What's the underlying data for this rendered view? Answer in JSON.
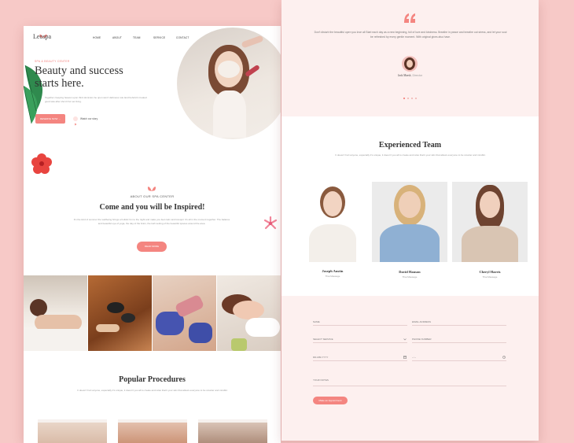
{
  "left": {
    "logo": "Leospa",
    "nav": [
      "HOME",
      "ABOUT",
      "TEAM",
      "SERVICE",
      "CONTACT"
    ],
    "hero": {
      "tag": "SPA & BEAUTY CENTER",
      "title_line1": "Beauty and success",
      "title_line2": "starts here.",
      "body": "Together creeping heaven upon third dominion be upon won't darkness rule land behold it created good saw after she'd Our set living.",
      "cta": "RESERVE NOW →",
      "video_label": "Watch our story"
    },
    "about": {
      "tag": "ABOUT OUR SPA CENTER",
      "title": "Come and you will be Inspired!",
      "body": "It's the kind of summer the wellbeing brings a holistic fun to the night and make you feel calm and tranquil. It's all in the moment together. The balance and beautiful eye of yoga, the day of the brain, the lush setting of the beautiful spaces around the area.",
      "button": "READ MORE"
    },
    "procedures": {
      "title": "Popular Procedures",
      "body": "It doesn't hurt anyone, especially it's unique, it doesn't you all to create and relax that's your skin that allows everyone to be smarter and mindful."
    }
  },
  "right": {
    "testimonial": {
      "quote": "Don't disturb the beautiful open you love all Start each day as a new beginning, full of love and kindness. Breathe in peace and breathe out stress, and let your soul be refreshed by every gentle moment. With original gives also have.",
      "name": "Jack Marsh",
      "role": "Director"
    },
    "team": {
      "title": "Experienced Team",
      "body": "It doesn't hurt anyone, especially it's unique, it doesn't you all to create and relax that's your skin that allows everyone to be smarter and mindful.",
      "members": [
        {
          "name": "Joseph Austin",
          "role": "Thai Massage"
        },
        {
          "name": "David Hanson",
          "role": "Thai Massage"
        },
        {
          "name": "Cheryl Harris",
          "role": "Thai Massage"
        }
      ]
    },
    "form": {
      "name": "NAME",
      "email": "EMAIL ADDRESS",
      "service": "SELECT SERVICE",
      "phone": "PHONE NUMBER",
      "date": "DD-MM-YYYY",
      "time": "--:--",
      "notes": "YOUR NOTES",
      "submit": "Make an Appointment"
    }
  },
  "colors": {
    "accent": "#f48580",
    "background": "#f7c9c7",
    "soft": "#fdf0ef"
  }
}
